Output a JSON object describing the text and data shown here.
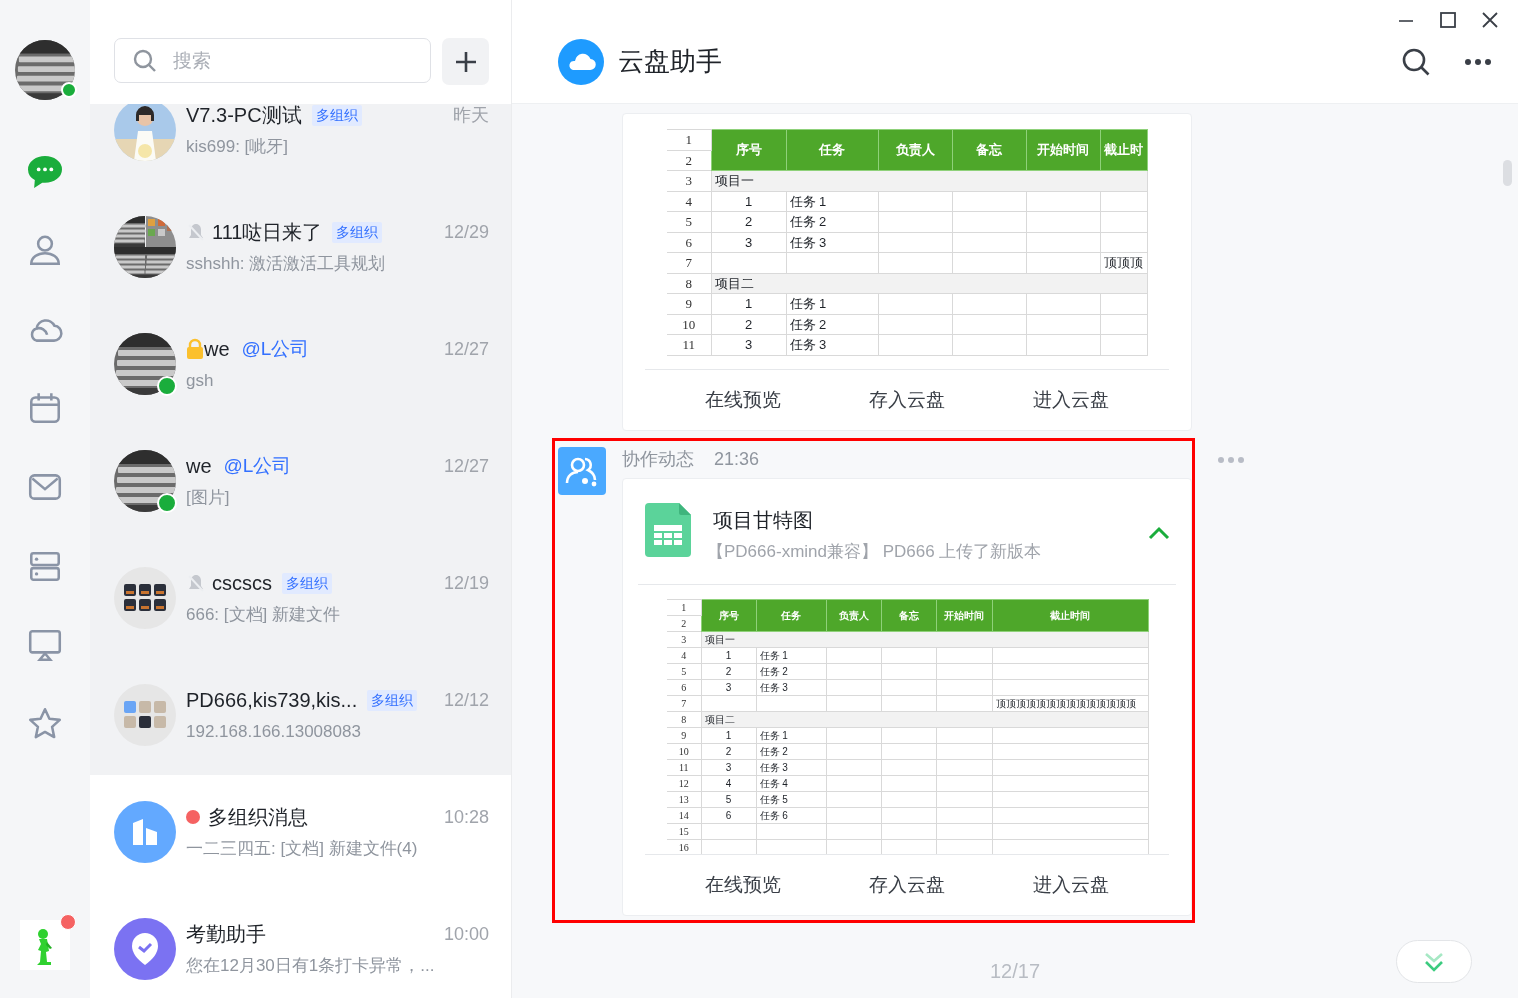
{
  "profile": {
    "online": true
  },
  "nav": {
    "items": [
      {
        "kind": "chat",
        "selected": true
      },
      {
        "kind": "contacts",
        "selected": false
      },
      {
        "kind": "cloud",
        "selected": false
      },
      {
        "kind": "calendar",
        "selected": false
      },
      {
        "kind": "mail",
        "selected": false
      },
      {
        "kind": "apps",
        "selected": false
      },
      {
        "kind": "screen",
        "selected": false
      },
      {
        "kind": "favorites",
        "selected": false
      }
    ]
  },
  "bottom_app": {
    "badge": true
  },
  "search": {
    "placeholder": "搜索"
  },
  "conversations": [
    {
      "name": "V7.3-PC测试",
      "tag": {
        "text": "多组织",
        "kind": "badge"
      },
      "time": "昨天",
      "preview": "kis699: [呲牙]",
      "pinned": true,
      "muted": false,
      "locked": false,
      "online": false,
      "unread": false
    },
    {
      "name": "111哒日来了",
      "tag": {
        "text": "多组织",
        "kind": "badge"
      },
      "time": "12/29",
      "preview": "sshshh: 激活激活工具规划",
      "pinned": true,
      "muted": true,
      "locked": false,
      "online": false,
      "unread": false
    },
    {
      "name": "we",
      "tag": {
        "text": "@L公司",
        "kind": "mention"
      },
      "time": "12/27",
      "preview": "gsh",
      "pinned": true,
      "muted": false,
      "locked": true,
      "online": true,
      "unread": false
    },
    {
      "name": "we",
      "tag": {
        "text": "@L公司",
        "kind": "mention"
      },
      "time": "12/27",
      "preview": "[图片]",
      "pinned": true,
      "muted": false,
      "locked": false,
      "online": true,
      "unread": false
    },
    {
      "name": "cscscs",
      "tag": {
        "text": "多组织",
        "kind": "badge"
      },
      "time": "12/19",
      "preview": "666: [文档] 新建文件",
      "avatar": {
        "kind": "group"
      },
      "pinned": true,
      "muted": true,
      "locked": false,
      "online": false,
      "unread": false
    },
    {
      "name": "PD666,kis739,kis...",
      "tag": {
        "text": "多组织",
        "kind": "badge"
      },
      "time": "12/12",
      "preview": "192.168.166.13008083",
      "avatar": {
        "kind": "group"
      },
      "pinned": true,
      "muted": false,
      "locked": false,
      "online": false,
      "unread": false
    },
    {
      "name": "多组织消息",
      "time": "10:28",
      "preview": "一二三四五: [文档] 新建文件(4)",
      "avatar": {
        "kind": "org"
      },
      "pinned": false,
      "muted": false,
      "locked": false,
      "online": false,
      "unread": true
    },
    {
      "name": "考勤助手",
      "time": "10:00",
      "preview": "您在12月30日有1条打卡异常，...",
      "avatar": {
        "kind": "attendance"
      },
      "pinned": false,
      "muted": false,
      "locked": false,
      "online": false,
      "unread": false
    }
  ],
  "header": {
    "title": "云盘助手"
  },
  "messages": [
    {
      "highlighted": false,
      "sheet": {
        "header_nums": [
          "1",
          "2"
        ],
        "columns": [
          "序号",
          "任务",
          "负责人",
          "备忘",
          "开始时间",
          "截止时"
        ],
        "rows": [
          {
            "num": "3",
            "kind": "section",
            "label": "项目一"
          },
          {
            "num": "4",
            "kind": "task",
            "cells": [
              "1",
              "任务 1"
            ]
          },
          {
            "num": "5",
            "kind": "task",
            "cells": [
              "2",
              "任务 2"
            ]
          },
          {
            "num": "6",
            "kind": "task",
            "cells": [
              "3",
              "任务 3"
            ]
          },
          {
            "num": "7",
            "kind": "note",
            "note": "顶顶顶"
          },
          {
            "num": "8",
            "kind": "section",
            "label": "项目二"
          },
          {
            "num": "9",
            "kind": "task",
            "cells": [
              "1",
              "任务 1"
            ]
          },
          {
            "num": "10",
            "kind": "task",
            "cells": [
              "2",
              "任务 2"
            ]
          },
          {
            "num": "11",
            "kind": "task",
            "cells": [
              "3",
              "任务 3"
            ]
          }
        ]
      },
      "actions": [
        "在线预览",
        "存入云盘",
        "进入云盘"
      ]
    },
    {
      "highlighted": true,
      "sender": "协作动态",
      "time": "21:36",
      "file": {
        "title": "项目甘特图",
        "subtitle": "【PD666-xmind兼容】 PD666 上传了新版本",
        "expanded": true
      },
      "sheet": {
        "header_nums": [
          "1",
          "2"
        ],
        "columns": [
          "序号",
          "任务",
          "负责人",
          "备忘",
          "开始时间",
          "截止时间"
        ],
        "rows": [
          {
            "num": "3",
            "kind": "section",
            "label": "项目一"
          },
          {
            "num": "4",
            "kind": "task",
            "cells": [
              "1",
              "任务 1"
            ]
          },
          {
            "num": "5",
            "kind": "task",
            "cells": [
              "2",
              "任务 2"
            ]
          },
          {
            "num": "6",
            "kind": "task",
            "cells": [
              "3",
              "任务 3"
            ]
          },
          {
            "num": "7",
            "kind": "note",
            "note": "顶顶顶顶顶顶顶顶顶顶顶顶顶顶"
          },
          {
            "num": "8",
            "kind": "section",
            "label": "项目二"
          },
          {
            "num": "9",
            "kind": "task",
            "cells": [
              "1",
              "任务 1"
            ]
          },
          {
            "num": "10",
            "kind": "task",
            "cells": [
              "2",
              "任务 2"
            ]
          },
          {
            "num": "11",
            "kind": "task",
            "cells": [
              "3",
              "任务 3"
            ]
          },
          {
            "num": "12",
            "kind": "task",
            "cells": [
              "4",
              "任务 4"
            ]
          },
          {
            "num": "13",
            "kind": "task",
            "cells": [
              "5",
              "任务 5"
            ]
          },
          {
            "num": "14",
            "kind": "task",
            "cells": [
              "6",
              "任务 6"
            ]
          },
          {
            "num": "15",
            "kind": "blank"
          },
          {
            "num": "16",
            "kind": "blank"
          }
        ]
      },
      "actions": [
        "在线预览",
        "存入云盘",
        "进入云盘"
      ]
    }
  ],
  "date_divider": "12/17"
}
